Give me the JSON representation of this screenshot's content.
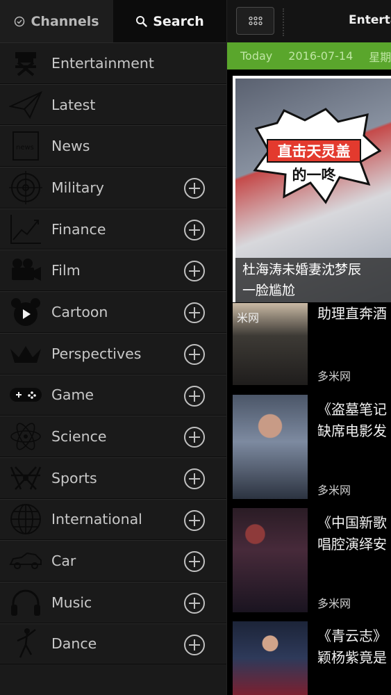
{
  "tabs": {
    "channels_label": "Channels",
    "search_label": "Search"
  },
  "channels": [
    {
      "label": "Entertainment",
      "icon": "director-chair-icon",
      "addable": false
    },
    {
      "label": "Latest",
      "icon": "paper-plane-icon",
      "addable": false
    },
    {
      "label": "News",
      "icon": "newspaper-icon",
      "addable": false
    },
    {
      "label": "Military",
      "icon": "crosshair-icon",
      "addable": true
    },
    {
      "label": "Finance",
      "icon": "trend-chart-icon",
      "addable": true
    },
    {
      "label": "Film",
      "icon": "movie-camera-icon",
      "addable": true
    },
    {
      "label": "Cartoon",
      "icon": "cartoon-mouse-icon",
      "addable": true
    },
    {
      "label": "Perspectives",
      "icon": "crown-icon",
      "addable": true
    },
    {
      "label": "Game",
      "icon": "gamepad-icon",
      "addable": true
    },
    {
      "label": "Science",
      "icon": "atom-icon",
      "addable": true
    },
    {
      "label": "Sports",
      "icon": "sports-icon",
      "addable": true
    },
    {
      "label": "International",
      "icon": "globe-icon",
      "addable": true
    },
    {
      "label": "Car",
      "icon": "car-icon",
      "addable": true
    },
    {
      "label": "Music",
      "icon": "headphones-icon",
      "addable": true
    },
    {
      "label": "Dance",
      "icon": "dancer-icon",
      "addable": true
    }
  ],
  "header": {
    "title": "Entertainment"
  },
  "datebar": {
    "today_label": "Today",
    "date": "2016-07-14",
    "weekday": "星期四"
  },
  "hero": {
    "burst_line1": "直击天灵盖",
    "burst_line2": "的一咚",
    "caption_line1": "杜海涛未婚妻沈梦辰",
    "caption_line2": "一脸尴尬"
  },
  "news": [
    {
      "title_line1": "助理直奔酒",
      "title_line2": "",
      "source": "多米网",
      "thumb_mark": "米网"
    },
    {
      "title_line1": "《盗墓笔记",
      "title_line2": "缺席电影发",
      "source": "多米网",
      "thumb_mark": ""
    },
    {
      "title_line1": "《中国新歌",
      "title_line2": "唱腔演绎安",
      "source": "多米网",
      "thumb_mark": ""
    },
    {
      "title_line1": "《青云志》",
      "title_line2": "颖杨紫竟是",
      "source": "",
      "thumb_mark": ""
    }
  ],
  "colors": {
    "sidebar_bg": "#1a1a1a",
    "accent_green": "#5aa62c",
    "text_light": "#c8c8c8"
  }
}
